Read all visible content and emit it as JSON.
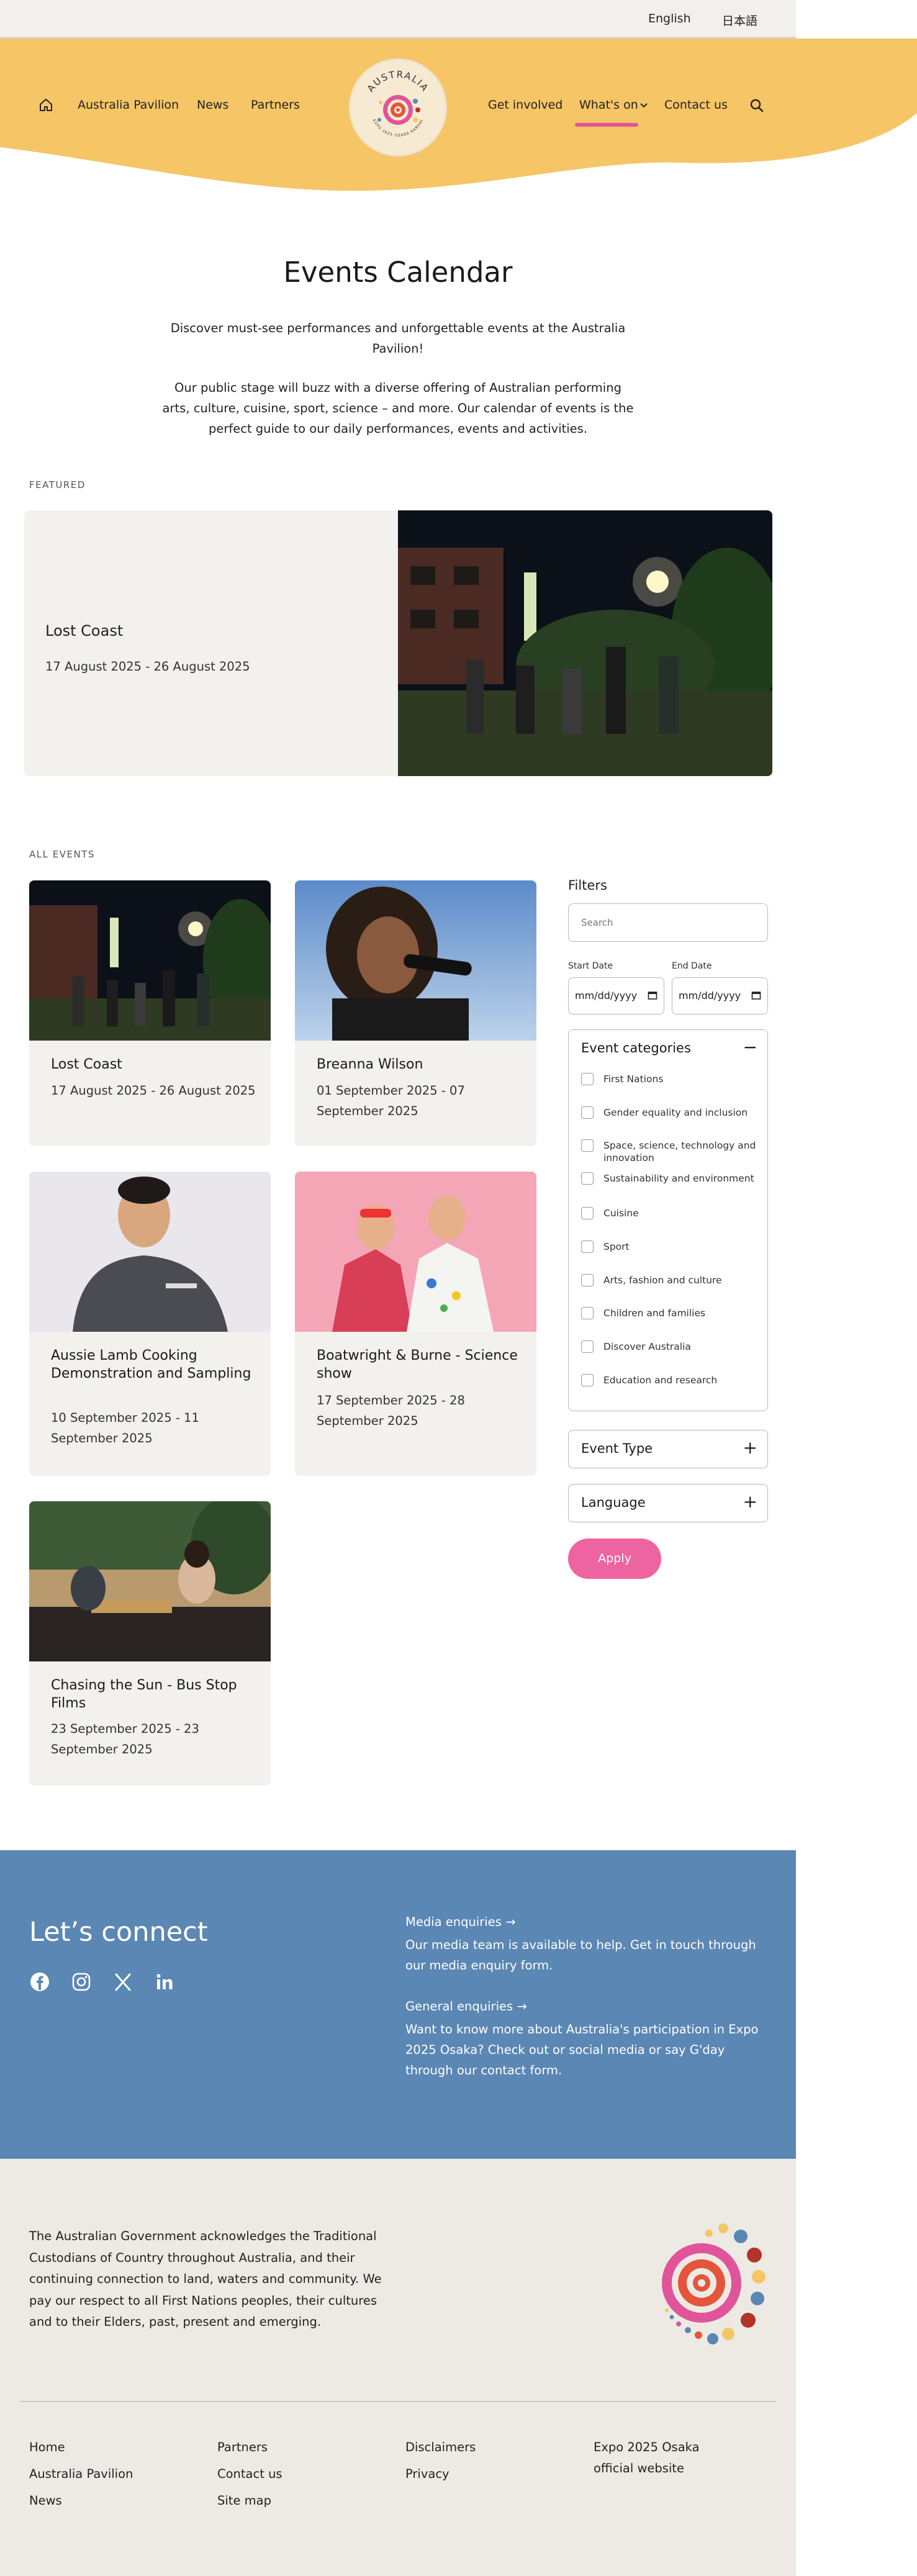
{
  "lang_bar": {
    "english": "English",
    "japanese": "日本語"
  },
  "nav": {
    "australia_pavilion": "Australia Pavilion",
    "news": "News",
    "partners": "Partners",
    "get_involved": "Get involved",
    "whats_on": "What's on",
    "contact_us": "Contact us"
  },
  "logo": {
    "wordmark": "AUSTRALIA",
    "subtitle": "EXPO 2025 OSAKA KANSAI"
  },
  "page": {
    "title": "Events Calendar",
    "intro_1": "Discover must-see performances and unforgettable events at the Australia Pavilion!",
    "intro_2": "Our public stage will buzz with a diverse offering of Australian performing arts, culture, cuisine, sport, science – and more. Our calendar of events is the perfect guide to our daily performances, events and activities."
  },
  "featured": {
    "label": "FEATURED",
    "title": "Lost Coast",
    "date": "17 August 2025 - 26 August 2025"
  },
  "all_events": {
    "label": "ALL EVENTS",
    "cards": [
      {
        "title": "Lost Coast",
        "date": "17 August 2025 - 26 August 2025"
      },
      {
        "title": "Breanna Wilson",
        "date": "01 September 2025 - 07 September 2025"
      },
      {
        "title": "Aussie Lamb Cooking Demonstration and Sampling",
        "date": "10 September 2025 - 11 September 2025"
      },
      {
        "title": "Boatwright & Burne - Science show",
        "date": "17 September 2025 - 28 September 2025"
      },
      {
        "title": "Chasing the Sun - Bus Stop Films",
        "date": "23 September 2025 - 23 September 2025"
      }
    ]
  },
  "filters": {
    "title": "Filters",
    "search_placeholder": "Search",
    "start_date_label": "Start Date",
    "end_date_label": "End Date",
    "date_placeholder": "mm/dd/yyyy",
    "event_categories": "Event categories",
    "categories": [
      "First Nations",
      "Gender equality and inclusion",
      "Space, science, technology and innovation",
      "Sustainability and environment",
      "Cuisine",
      "Sport",
      "Arts, fashion and culture",
      "Children and families",
      "Discover Australia",
      "Education and research"
    ],
    "event_type": "Event Type",
    "language": "Language",
    "apply": "Apply"
  },
  "connect": {
    "title": "Let’s connect",
    "media_link": "Media enquiries",
    "media_text": "Our media team is available to help. Get in touch through our media enquiry form.",
    "general_link": "General enquiries",
    "general_text": "Want to know more about Australia's participation in Expo 2025 Osaka? Check out or social media or say G'day through our contact form."
  },
  "footer": {
    "acknowledgement": "The Australian Government acknowledges the Traditional Custodians of Country throughout Australia, and their continuing connection to land, waters and community. We pay our respect to all First Nations peoples, their cultures and to their Elders, past, present and emerging.",
    "col1": [
      "Home",
      "Australia Pavilion",
      "News"
    ],
    "col2": [
      "Partners",
      "Contact us",
      "Site map"
    ],
    "col3": [
      "Disclaimers",
      "Privacy"
    ],
    "col4": [
      "Expo 2025 Osaka official website"
    ]
  },
  "colors": {
    "header_yellow": "#f5c566",
    "accent_pink": "#e0549a",
    "connect_blue": "#5b87b4",
    "footer_bg": "#edeae4"
  }
}
